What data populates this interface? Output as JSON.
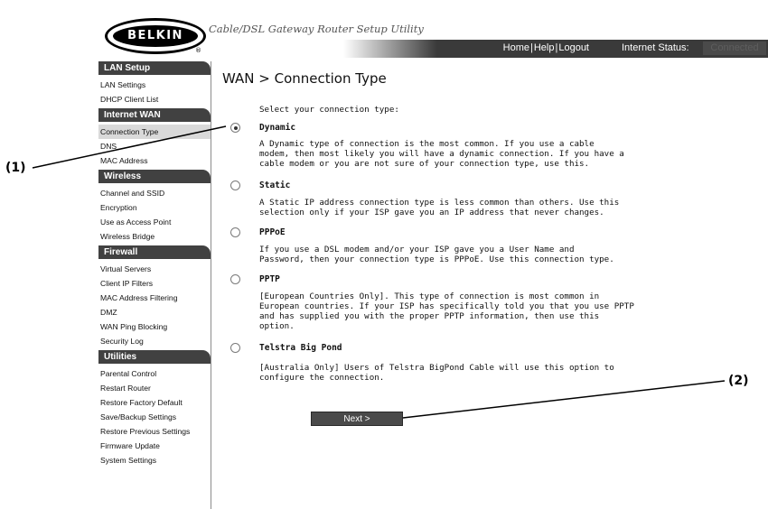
{
  "brand": {
    "logo_text": "BELKIN",
    "registered_mark": "®"
  },
  "app_title": "Cable/DSL Gateway Router Setup Utility",
  "topbar": {
    "links": [
      "Home",
      "Help",
      "Logout"
    ],
    "separator": "|",
    "status_label": "Internet Status:",
    "status_value": "Connected"
  },
  "sidebar": {
    "sections": [
      {
        "title": "LAN Setup",
        "items": [
          {
            "label": "LAN Settings",
            "active": false
          },
          {
            "label": "DHCP Client List",
            "active": false
          }
        ]
      },
      {
        "title": "Internet WAN",
        "items": [
          {
            "label": "Connection Type",
            "active": true
          },
          {
            "label": "DNS",
            "active": false
          },
          {
            "label": "MAC Address",
            "active": false
          }
        ]
      },
      {
        "title": "Wireless",
        "items": [
          {
            "label": "Channel and SSID",
            "active": false
          },
          {
            "label": "Encryption",
            "active": false
          },
          {
            "label": "Use as Access Point",
            "active": false
          },
          {
            "label": "Wireless Bridge",
            "active": false
          }
        ]
      },
      {
        "title": "Firewall",
        "items": [
          {
            "label": "Virtual Servers",
            "active": false
          },
          {
            "label": "Client IP Filters",
            "active": false
          },
          {
            "label": "MAC Address Filtering",
            "active": false
          },
          {
            "label": "DMZ",
            "active": false
          },
          {
            "label": "WAN Ping Blocking",
            "active": false
          },
          {
            "label": "Security Log",
            "active": false
          }
        ]
      },
      {
        "title": "Utilities",
        "items": [
          {
            "label": "Parental Control",
            "active": false
          },
          {
            "label": "Restart Router",
            "active": false
          },
          {
            "label": "Restore Factory Default",
            "active": false
          },
          {
            "label": "Save/Backup Settings",
            "active": false
          },
          {
            "label": "Restore Previous Settings",
            "active": false
          },
          {
            "label": "Firmware Update",
            "active": false
          },
          {
            "label": "System Settings",
            "active": false
          }
        ]
      }
    ]
  },
  "main": {
    "title": "WAN > Connection Type",
    "intro": "Select your connection type:",
    "options": [
      {
        "title": "Dynamic",
        "selected": true,
        "desc": [
          "A Dynamic type of connection is the most common. If you use a cable",
          "modem, then most likely you will have a dynamic connection. If you have a",
          "cable modem or you are not sure of your connection type, use this."
        ]
      },
      {
        "title": "Static",
        "selected": false,
        "desc": [
          "A Static IP address connection type is less common than others. Use this",
          "selection only if your ISP gave you an IP address that never changes."
        ]
      },
      {
        "title": "PPPoE",
        "selected": false,
        "desc": [
          "If you use a DSL modem and/or your ISP gave you a User Name and",
          "Password, then your connection type is PPPoE. Use this connection type."
        ]
      },
      {
        "title": "PPTP",
        "selected": false,
        "desc": [
          "[European Countries Only]. This type of connection is most common in",
          "European countries. If your ISP has specifically told you that you use PPTP",
          "and has supplied you with the proper PPTP information, then use this",
          "option."
        ]
      },
      {
        "title": "Telstra Big Pond",
        "selected": false,
        "desc": [
          "[Australia Only] Users of Telstra BigPond Cable will use this option to",
          "configure the connection."
        ]
      }
    ],
    "next_button": "Next >"
  },
  "callouts": [
    "(1)",
    "(2)"
  ]
}
